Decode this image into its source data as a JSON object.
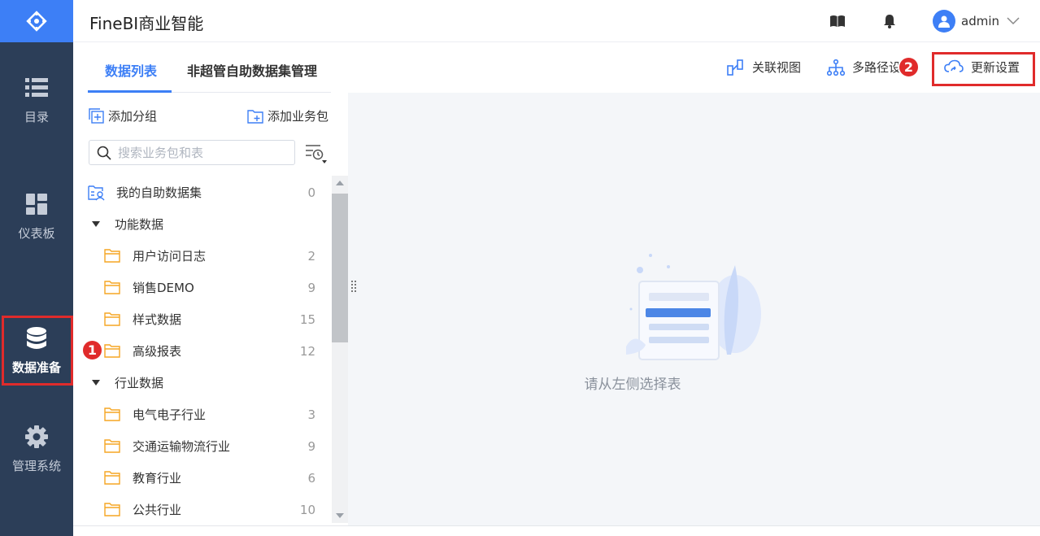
{
  "app": {
    "title": "FineBI商业智能",
    "user": "admin"
  },
  "rail": {
    "items": [
      {
        "label": "目录",
        "icon": "list-icon"
      },
      {
        "label": "仪表板",
        "icon": "dashboard-icon"
      },
      {
        "label": "数据准备",
        "icon": "database-icon",
        "active": true
      },
      {
        "label": "管理系统",
        "icon": "gear-icon"
      }
    ]
  },
  "tabs": {
    "active": "数据列表",
    "other": "非超管自助数据集管理"
  },
  "actions": {
    "relation_view": "关联视图",
    "multi_path": "多路径设",
    "update_settings": "更新设置"
  },
  "panel": {
    "add_group": "添加分组",
    "add_package": "添加业务包",
    "search_placeholder": "搜索业务包和表"
  },
  "tree": {
    "my_dataset": {
      "label": "我的自助数据集",
      "count": "0"
    },
    "groups": [
      {
        "label": "功能数据",
        "items": [
          {
            "label": "用户访问日志",
            "count": "2"
          },
          {
            "label": "销售DEMO",
            "count": "9"
          },
          {
            "label": "样式数据",
            "count": "15"
          },
          {
            "label": "高级报表",
            "count": "12"
          }
        ]
      },
      {
        "label": "行业数据",
        "items": [
          {
            "label": "电气电子行业",
            "count": "3"
          },
          {
            "label": "交通运输物流行业",
            "count": "9"
          },
          {
            "label": "教育行业",
            "count": "6"
          },
          {
            "label": "公共行业",
            "count": "10"
          }
        ]
      }
    ]
  },
  "content": {
    "empty_text": "请从左侧选择表"
  },
  "badges": {
    "one": "1",
    "two": "2"
  },
  "colors": {
    "accent": "#3d7ff6",
    "rail": "#2c3e58",
    "highlight": "#e02b2b",
    "folder": "#f5a623"
  }
}
